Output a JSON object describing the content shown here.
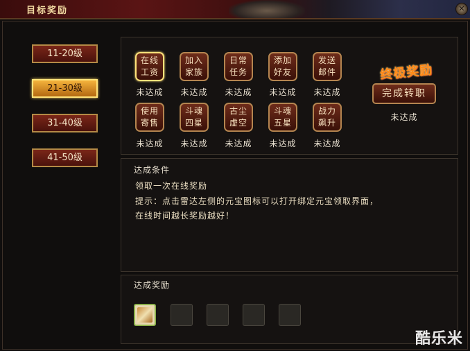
{
  "window": {
    "title": "目标奖励"
  },
  "levels": [
    {
      "label": "11-20级",
      "selected": false
    },
    {
      "label": "21-30级",
      "selected": true
    },
    {
      "label": "31-40级",
      "selected": false
    },
    {
      "label": "41-50级",
      "selected": false
    }
  ],
  "tasks": [
    {
      "label": "在线\n工资",
      "status": "未达成",
      "selected": true
    },
    {
      "label": "加入\n家族",
      "status": "未达成",
      "selected": false
    },
    {
      "label": "日常\n任务",
      "status": "未达成",
      "selected": false
    },
    {
      "label": "添加\n好友",
      "status": "未达成",
      "selected": false
    },
    {
      "label": "发送\n邮件",
      "status": "未达成",
      "selected": false
    },
    {
      "label": "使用\n寄售",
      "status": "未达成",
      "selected": false
    },
    {
      "label": "斗魂\n四星",
      "status": "未达成",
      "selected": false
    },
    {
      "label": "古尘\n虚空",
      "status": "未达成",
      "selected": false
    },
    {
      "label": "斗魂\n五星",
      "status": "未达成",
      "selected": false
    },
    {
      "label": "战力\n飙升",
      "status": "未达成",
      "selected": false
    }
  ],
  "ultimate": {
    "title": "终极奖励",
    "button": "完成转职",
    "status": "未达成"
  },
  "conditions": {
    "header": "达成条件",
    "lines": [
      "领取一次在线奖励",
      "提示：点击雷达左侧的元宝图标可以打开绑定元宝领取界面，",
      "在线时间越长奖励越好！"
    ]
  },
  "rewards": {
    "header": "达成奖励",
    "slots": [
      true,
      false,
      false,
      false,
      false
    ]
  },
  "watermark": "酷乐米"
}
